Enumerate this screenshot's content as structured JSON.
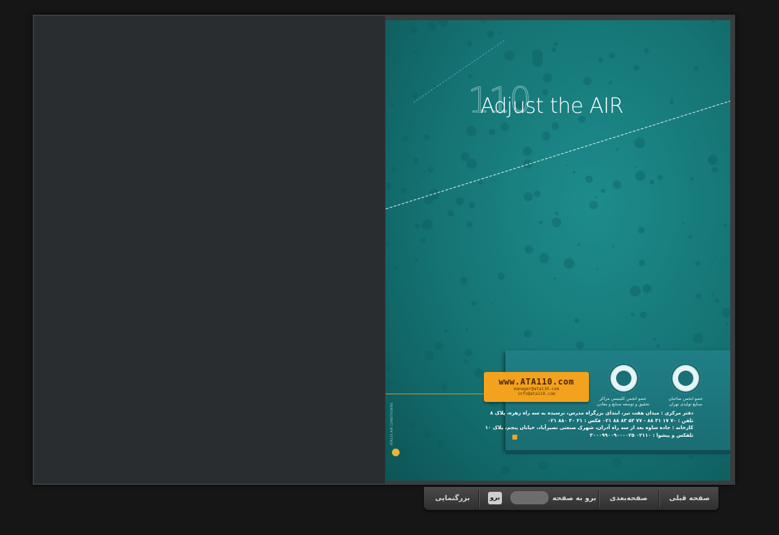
{
  "page": {
    "big_number": "110",
    "tagline": "Adjust the AIR",
    "side_caption": "ATA110 AIR CONDITIONING",
    "url_badge": {
      "main": "www.ATA110.com",
      "email_1": "manager@ata110.com",
      "email_2": "info@ata110.com"
    },
    "seals": {
      "left_caption_1": "عضو انجمن کلینیسن مراکز",
      "left_caption_2": "تحقیق و توسعه صنایع و معادن",
      "right_caption_1": "عضو انجمن صاحبان",
      "right_caption_2": "صنایع تولیدی تهران"
    },
    "address": {
      "line_1": "دفتر مرکزی : میدان هفت تیر، ابتدای بزرگراه مدرس، نرسیده به سه راه زهره، پلاک ۸",
      "line_2": "تلفن : ۷۰ ۱۷ ۳۱ ۸۸ - ۷۷ ۵۳ ۸۳ ۸۸ ۰۲۱    فکس : ۲۱ ۳۰ ۸۸۰ ۰۲۱",
      "line_3": "کارخانه : جاده ساوه بعد از سه راه آدران، شهرک صنعتی نصیرآباد، خیابان پنجم، پلاک ۱۰",
      "line_4": "تلفکس و پیشوا : ۰۲۱۱۰          ۳۰۰۰۹۹۰۰۹۰۰۰۰۲۵"
    }
  },
  "toolbar": {
    "prev_page": "صفحه قبلی",
    "next_page": "صفحه‌بعدی",
    "goto_page": "برو به صفحه",
    "page_input_value": "",
    "go_button": "برو",
    "zoom": "بزرگنمایی"
  },
  "colors": {
    "page_teal": "#157373",
    "badge_orange": "#f3a21d",
    "background": "#161616"
  }
}
